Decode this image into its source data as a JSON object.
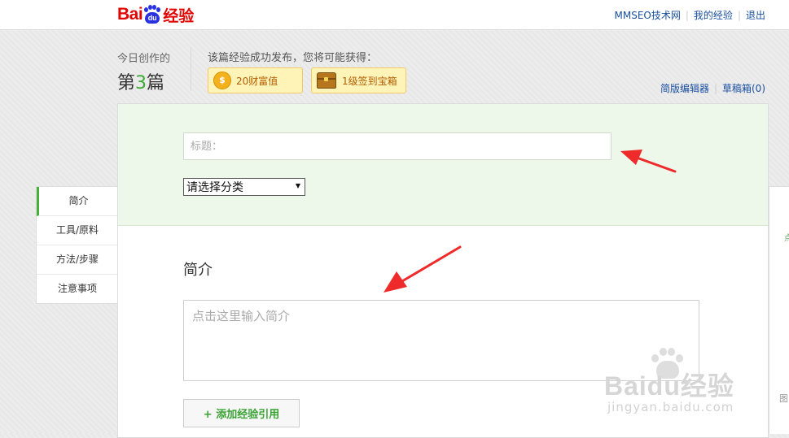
{
  "header": {
    "logo": {
      "bai": "Bai",
      "du": "du",
      "jingyan": "经验"
    },
    "links": [
      "MMSEO技术网",
      "我的经验",
      "退出"
    ]
  },
  "today": {
    "label": "今日创作的",
    "prefix": "第",
    "count": "3",
    "suffix": "篇"
  },
  "reward": {
    "title": "该篇经验成功发布，您将可能获得：",
    "wealth": "20财富值",
    "chest": "1级签到宝箱"
  },
  "editor_links": {
    "simple_editor": "简版编辑器",
    "drafts": "草稿箱(0)"
  },
  "left_nav": [
    "简介",
    "工具/原料",
    "方法/步骤",
    "注意事项"
  ],
  "form": {
    "title_placeholder": "标题：",
    "category": "请选择分类",
    "intro_heading": "简介",
    "intro_placeholder": "点击这里输入简介",
    "add_reference": "+ 添加经验引用"
  },
  "right_panel": {
    "frag1": "点",
    "frag2": "图"
  },
  "watermark": {
    "text": "Baidu经验",
    "url": "jingyan.baidu.com"
  },
  "colors": {
    "brand_red": "#e10602",
    "brand_blue": "#2932e1",
    "accent_green": "#3bab35",
    "arrow_red": "#ee2a2a"
  }
}
